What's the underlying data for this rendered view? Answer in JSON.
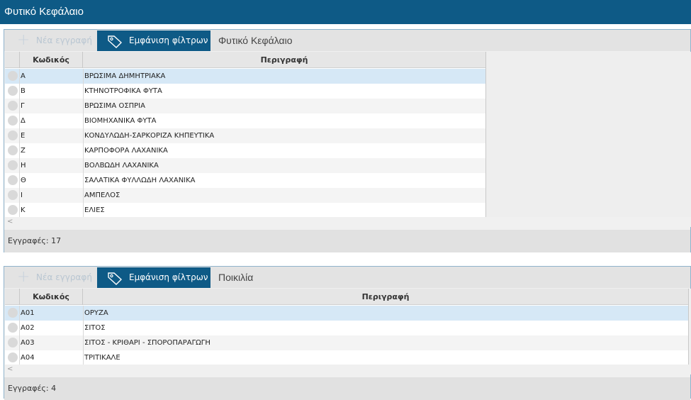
{
  "window": {
    "title": "Φυτικό Κεφάλαιο"
  },
  "panels": [
    {
      "toolbar": {
        "new_label": "Νέα εγγραφή",
        "filter_label": "Εμφάνιση φίλτρων",
        "title": "Φυτικό Κεφάλαιο"
      },
      "columns": {
        "code": "Κωδικός",
        "description": "Περιγραφή"
      },
      "rows": [
        {
          "code": "Α",
          "description": "ΒΡΩΣΙΜΑ ΔΗΜΗΤΡΙΑΚΑ"
        },
        {
          "code": "Β",
          "description": "ΚΤΗΝΟΤΡΟΦΙΚΑ ΦΥΤΑ"
        },
        {
          "code": "Γ",
          "description": "ΒΡΩΣΙΜΑ ΟΣΠΡΙΑ"
        },
        {
          "code": "Δ",
          "description": "ΒΙΟΜΗΧΑΝΙΚΑ ΦΥΤΑ"
        },
        {
          "code": "Ε",
          "description": "ΚΟΝΔΥΛΩΔΗ-ΣΑΡΚΟΡΙΖΑ ΚΗΠΕΥΤΙΚΑ"
        },
        {
          "code": "Ζ",
          "description": "ΚΑΡΠΟΦΟΡΑ ΛΑΧΑΝΙΚΑ"
        },
        {
          "code": "Η",
          "description": "ΒΟΛΒΩΔΗ ΛΑΧΑΝΙΚΑ"
        },
        {
          "code": "Θ",
          "description": "ΣΑΛΑΤΙΚΑ ΦΥΛΛΩΔΗ ΛΑΧΑΝΙΚΑ"
        },
        {
          "code": "Ι",
          "description": "ΑΜΠΕΛΟΣ"
        },
        {
          "code": "Κ",
          "description": "ΕΛΙΕΣ"
        }
      ],
      "footer": "Εγγραφές: 17"
    },
    {
      "toolbar": {
        "new_label": "Νέα εγγραφή",
        "filter_label": "Εμφάνιση φίλτρων",
        "title": "Ποικιλία"
      },
      "columns": {
        "code": "Κωδικός",
        "description": "Περιγραφή"
      },
      "rows": [
        {
          "code": "Α01",
          "description": "ΟΡΥΖΑ"
        },
        {
          "code": "Α02",
          "description": "ΣΙΤΟΣ"
        },
        {
          "code": "Α03",
          "description": "ΣΙΤΟΣ - ΚΡΙΘΑΡΙ - ΣΠΟΡΟΠΑΡΑΓΩΓΗ"
        },
        {
          "code": "Α04",
          "description": "ΤΡΙΤΙΚΑΛΕ"
        }
      ],
      "footer": "Εγγραφές: 4"
    }
  ],
  "colors": {
    "accent": "#0e5a86",
    "selected_row": "#d6e8f6"
  }
}
